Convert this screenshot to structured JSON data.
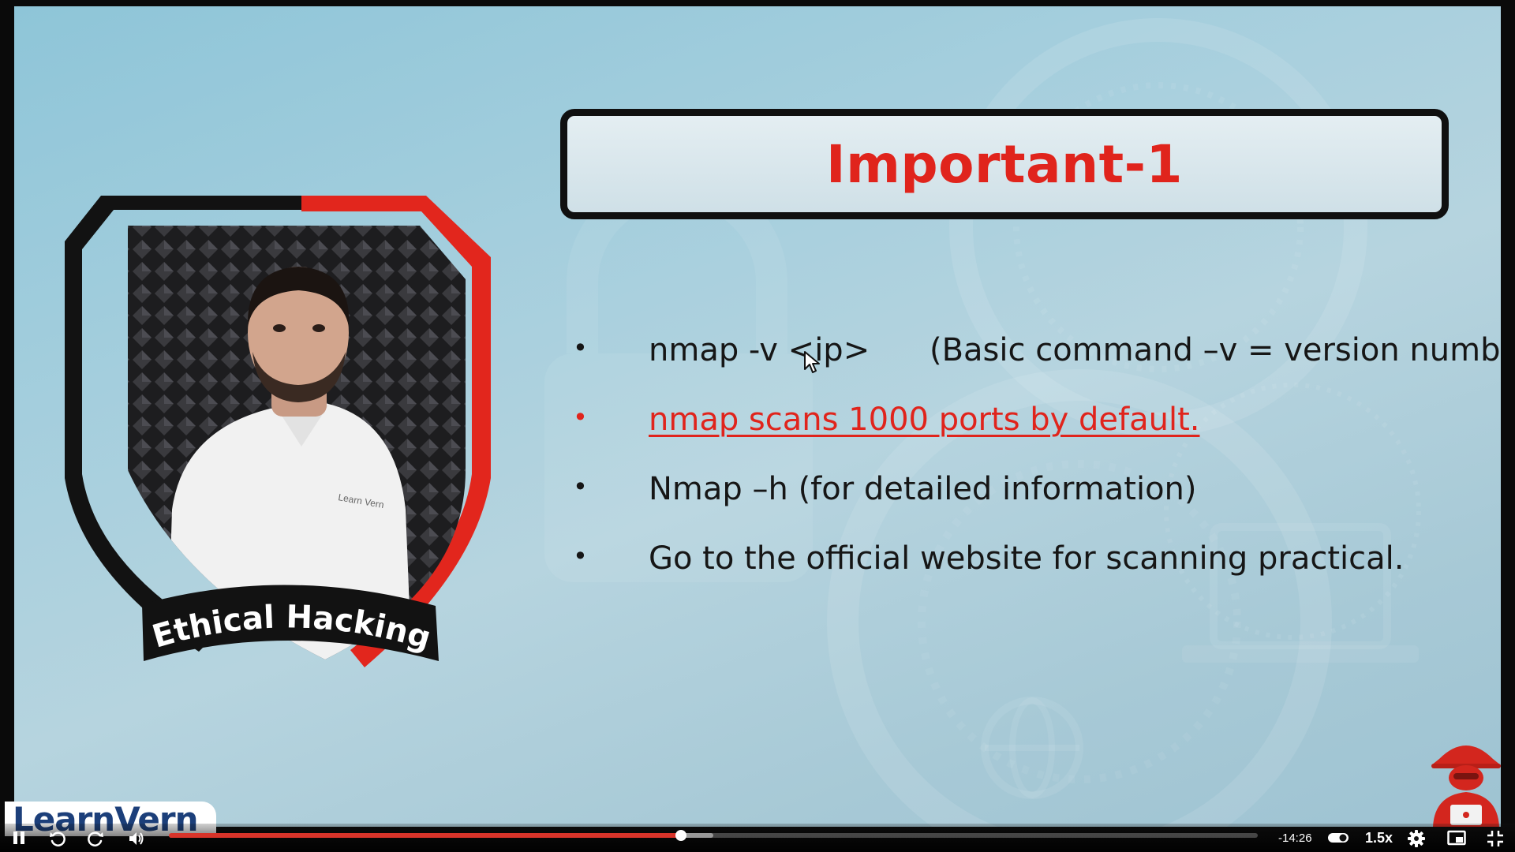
{
  "slide": {
    "title": "Important-1",
    "bullets": [
      {
        "text": "nmap  -v <ip>",
        "note": "(Basic command –v = version number)",
        "highlight": false
      },
      {
        "text": "nmap scans 1000 ports by default.",
        "note": "",
        "highlight": true
      },
      {
        "text": "Nmap –h (for detailed information)",
        "note": "",
        "highlight": false
      },
      {
        "text": "Go to the official website for scanning practical.",
        "note": "",
        "highlight": false
      }
    ],
    "bullet_glyph": "•",
    "presenter_banner": "Ethical Hacking",
    "presenter_shirt_logo": "Learn Vern"
  },
  "branding": {
    "logo": "LearnVern"
  },
  "colors": {
    "title_red": "#e0241c",
    "shield_red": "#e2261d",
    "shield_black": "#121212",
    "progress_red": "#d8342a"
  },
  "player": {
    "time_remaining": "-14:26",
    "speed": "1.5x",
    "progress_fraction": 0.47,
    "buffered_fraction": 0.5,
    "icons": [
      "pause-icon",
      "rewind-icon",
      "forward-icon",
      "volume-icon",
      "captions-toggle-icon",
      "settings-gear-icon",
      "pip-icon",
      "fullscreen-exit-icon"
    ]
  }
}
